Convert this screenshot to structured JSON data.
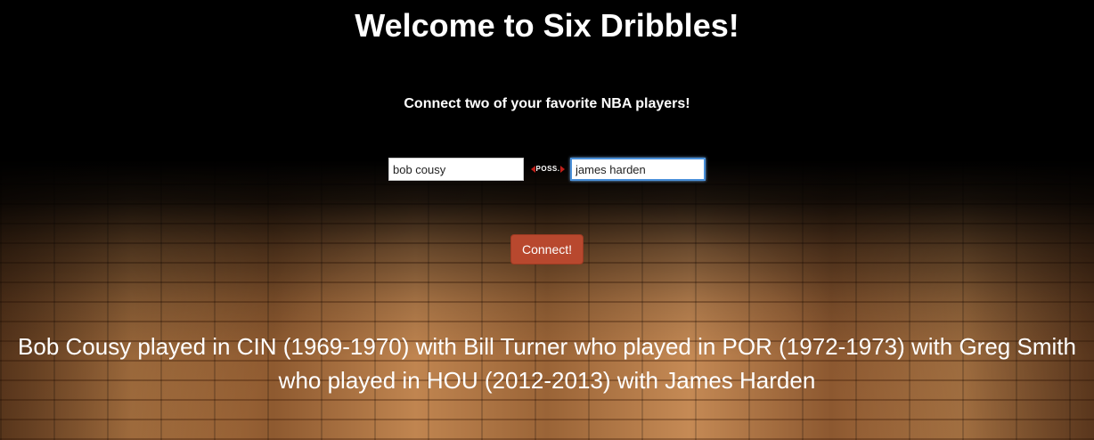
{
  "header": {
    "title": "Welcome to Six Dribbles!",
    "subtitle": "Connect two of your favorite NBA players!"
  },
  "form": {
    "player_a_value": "bob cousy",
    "player_b_value": "james harden",
    "connector_label": "POSS.",
    "connect_label": "Connect!"
  },
  "result": {
    "text": "Bob Cousy played in CIN (1969-1970) with Bill Turner who played in POR (1972-1973) with Greg Smith who played in HOU (2012-2013) with James Harden"
  },
  "colors": {
    "button": "#b8482e",
    "focus_border": "#4a90d9",
    "poss_arrow": "#c0201a"
  },
  "icons": {
    "left_arrow": "arrow-left-icon",
    "right_arrow": "arrow-right-icon"
  }
}
